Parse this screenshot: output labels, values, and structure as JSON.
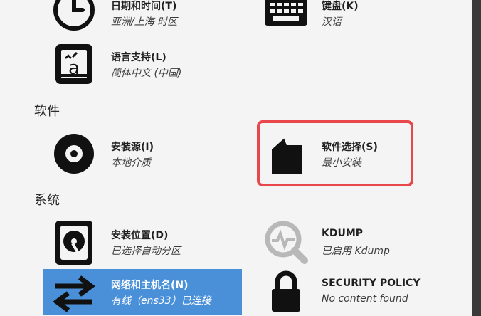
{
  "sections": {
    "localization": {
      "datetime": {
        "title": "日期和时间(T)",
        "status": "亚洲/上海 时区",
        "icon": "clock-icon"
      },
      "keyboard": {
        "title": "键盘(K)",
        "status": "汉语",
        "icon": "keyboard-icon"
      },
      "language": {
        "title": "语言支持(L)",
        "status": "简体中文 (中国)",
        "icon": "language-icon"
      }
    },
    "software": {
      "heading": "软件",
      "source": {
        "title": "安装源(I)",
        "status": "本地介质",
        "icon": "disc-icon"
      },
      "selection": {
        "title": "软件选择(S)",
        "status": "最小安装",
        "icon": "package-icon"
      }
    },
    "system": {
      "heading": "系统",
      "destination": {
        "title": "安装位置(D)",
        "status": "已选择自动分区",
        "icon": "harddisk-icon"
      },
      "kdump": {
        "title": "KDUMP",
        "status": "已启用 Kdump",
        "icon": "kdump-search-icon"
      },
      "network": {
        "title": "网络和主机名(N)",
        "status": "有线（ens33）已连接",
        "icon": "network-icon"
      },
      "security": {
        "title": "SECURITY POLICY",
        "status": "No content found",
        "icon": "lock-icon"
      }
    }
  },
  "colors": {
    "selected_bg": "#4a90d9",
    "highlight_border": "#e8474b",
    "background": "#f4f4f4"
  }
}
